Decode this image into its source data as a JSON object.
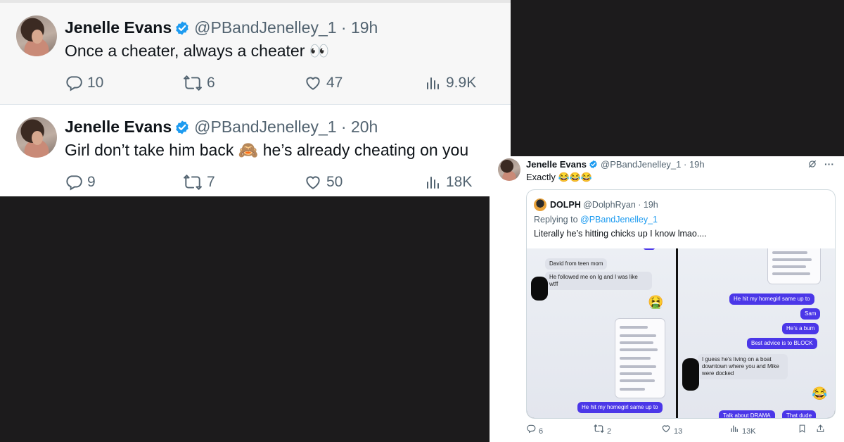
{
  "tweet1": {
    "name": "Jenelle Evans",
    "handle": "@PBandJenelley_1",
    "time": "· 19h",
    "text": "Once a cheater, always a cheater 👀",
    "replies": "10",
    "retweets": "6",
    "likes": "47",
    "views": "9.9K"
  },
  "tweet2": {
    "name": "Jenelle Evans",
    "handle": "@PBandJenelley_1",
    "time": "· 20h",
    "text": "Girl don’t take him back 🙈 he’s already cheating on you",
    "replies": "9",
    "retweets": "7",
    "likes": "50",
    "views": "18K"
  },
  "tweet3": {
    "name": "Jenelle Evans",
    "handle": "@PBandJenelley_1",
    "time": "· 19h",
    "text": "Exactly 😂😂😂",
    "more": "···",
    "quote": {
      "name": "DOLPH",
      "handle": "@DolphRyan",
      "time": "· 19h",
      "replying_prefix": "Replying to ",
      "replying_handle": "@PBandJenelley_1",
      "text": "Literally he’s hitting chicks up I know lmao....",
      "screenshot_left": {
        "msg1": "David from teen mom",
        "msg2a": "He followed me on Ig and I was like",
        "msg2b": "wtff",
        "msg3": "He hit my homegirl same up to"
      },
      "screenshot_right": {
        "msg1": "He hit my homegirl same up to",
        "msg2": "Sam",
        "msg3": "He’s a bum",
        "msg4": "Best advice is to BLOCK",
        "msg5a": "I guess he’s living on a boat",
        "msg5b": "downtown where you and Mike",
        "msg5c": "were docked",
        "msg6": "Talk about DRAMA",
        "msg7": "That dude"
      }
    },
    "replies": "6",
    "retweets": "2",
    "likes": "13",
    "views": "13K"
  },
  "colors": {
    "verified": "#1d9bf0",
    "muted": "#536471",
    "bubble_out": "#4b37e8",
    "background": "#1c1b1c"
  },
  "icons": [
    "verified-badge-icon",
    "reply-icon",
    "retweet-icon",
    "like-icon",
    "views-icon",
    "grok-icon",
    "more-icon",
    "bookmark-icon",
    "share-icon"
  ]
}
